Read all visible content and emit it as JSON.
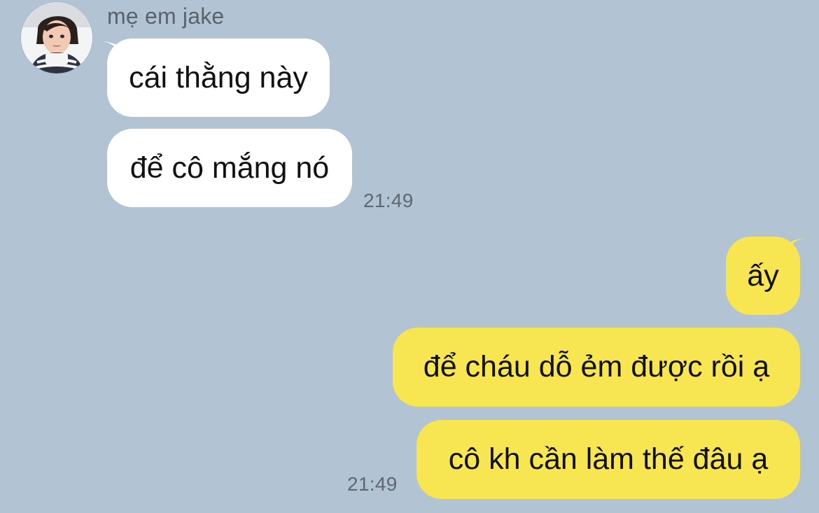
{
  "chat": {
    "incoming_group": {
      "sender": "mẹ em jake",
      "avatar_icon": "child-profile-avatar",
      "messages": [
        "cái thằng này",
        "để cô mắng nó"
      ],
      "time": "21:49"
    },
    "outgoing_group": {
      "messages": [
        "ấy",
        "để cháu dỗ ẻm được rồi ạ",
        "cô kh cần làm thế đâu ạ"
      ],
      "time": "21:49"
    }
  },
  "colors": {
    "background": "#b2c3d3",
    "incoming_bubble": "#ffffff",
    "outgoing_bubble": "#f8e552"
  }
}
